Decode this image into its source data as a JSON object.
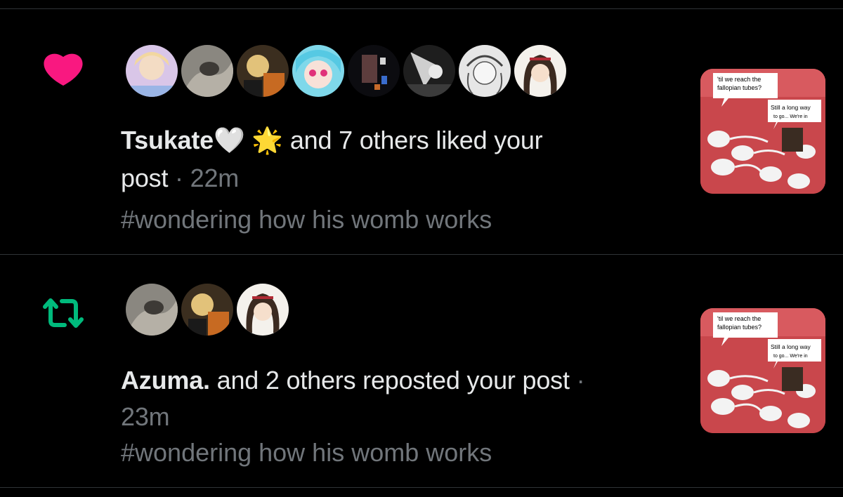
{
  "top_divider": true,
  "notifications": [
    {
      "type": "like",
      "icon": "heart-icon",
      "icon_color": "#f91880",
      "avatars": [
        "avatar-1",
        "avatar-2",
        "avatar-3",
        "avatar-4",
        "avatar-5",
        "avatar-6",
        "avatar-7",
        "avatar-8"
      ],
      "actor_name": "Tsukate",
      "actor_emoji": "🤍 🌟",
      "action_text": " and 7 others liked your",
      "action_text_2": "post",
      "separator": " · ",
      "time": "22m",
      "hashtag": "#wondering how his womb works",
      "thumb_text": {
        "line1": "'til we reach the",
        "line2": "fallopian tubes?",
        "line3": "Still a long way",
        "line4": "to go... We're in"
      }
    },
    {
      "type": "repost",
      "icon": "repost-icon",
      "icon_color": "#00ba7c",
      "avatars": [
        "avatar-2",
        "avatar-3",
        "avatar-8"
      ],
      "actor_name": "Azuma.",
      "action_text": " and 2 others reposted your post",
      "separator": " ·",
      "time": "23m",
      "hashtag": "#wondering how his womb works",
      "thumb_text": {
        "line1": "'til we reach the",
        "line2": "fallopian tubes?",
        "line3": "Still a long way",
        "line4": "to go... We're in"
      }
    }
  ],
  "colors": {
    "background": "#000000",
    "primary_text": "#e7e9ea",
    "secondary_text": "#71767b",
    "divider": "#2f3336",
    "like": "#f91880",
    "repost": "#00ba7c"
  }
}
